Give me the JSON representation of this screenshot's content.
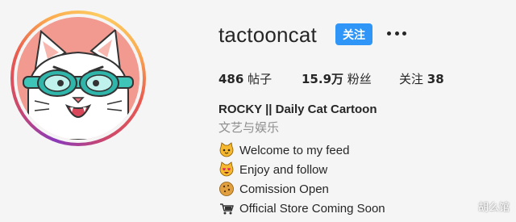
{
  "profile": {
    "username": "tactooncat",
    "follow_label": "关注",
    "more_icon": "more-horizontal-icon",
    "avatar_icon": "cat-goggles-avatar"
  },
  "stats": {
    "posts_value": "486",
    "posts_label": "帖子",
    "followers_value": "15.9万",
    "followers_label": "粉丝",
    "following_label": "关注",
    "following_value": "38"
  },
  "bio": {
    "name": "ROCKY || Daily Cat Cartoon",
    "category": "文艺与娱乐",
    "lines": [
      {
        "icon": "cat-face-icon",
        "text": "Welcome to my feed"
      },
      {
        "icon": "heart-eyes-cat-icon",
        "text": "Enjoy and follow"
      },
      {
        "icon": "cookie-icon",
        "text": "Comission Open"
      },
      {
        "icon": "shopping-icon",
        "text": "Official Store Coming Soon"
      }
    ]
  },
  "watermark": "胡么馆",
  "colors": {
    "follow_button": "#2f95f6",
    "avatar_background": "#f29a8f",
    "category_text": "#8e8e8e"
  }
}
